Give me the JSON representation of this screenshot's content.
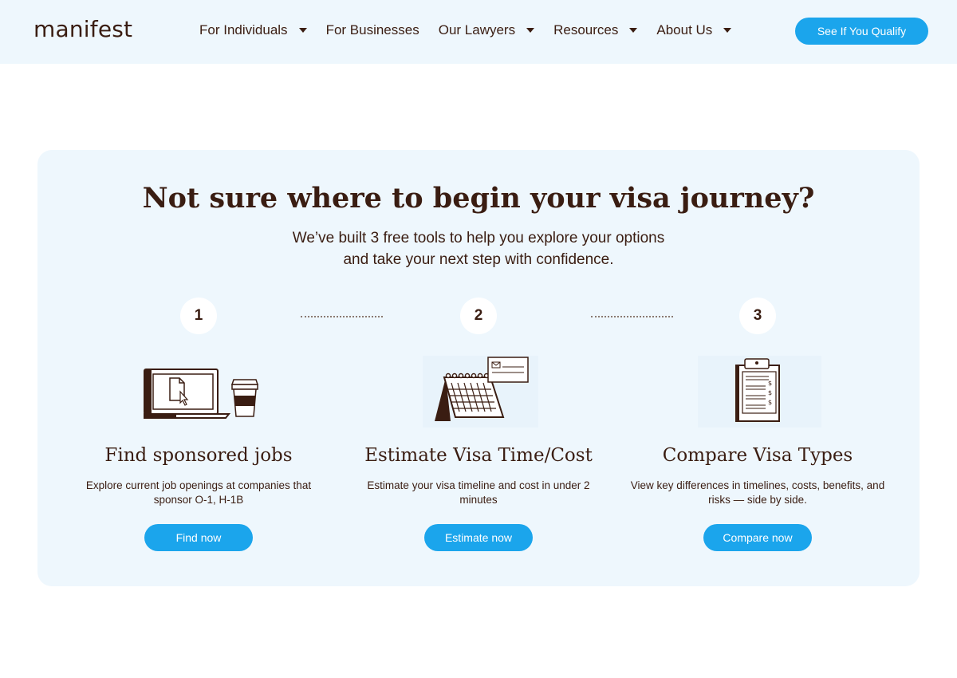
{
  "header": {
    "logo": "manifest",
    "nav": [
      {
        "label": "For Individuals",
        "has_dropdown": true
      },
      {
        "label": "For Businesses",
        "has_dropdown": false
      },
      {
        "label": "Our Lawyers",
        "has_dropdown": true
      },
      {
        "label": "Resources",
        "has_dropdown": true
      },
      {
        "label": "About Us",
        "has_dropdown": true
      }
    ],
    "cta": "See If You Qualify"
  },
  "hero": {
    "title": "Not sure where to begin your visa journey?",
    "subtitle": "We’ve built 3 free tools to help you explore your options and take your next step with confidence."
  },
  "steps": [
    "1",
    "2",
    "3"
  ],
  "tools": [
    {
      "icon": "laptop-coffee-icon",
      "title": "Find sponsored jobs",
      "description": "Explore current job openings at companies that sponsor O-1, H-1B",
      "button": "Find now"
    },
    {
      "icon": "calendar-icon",
      "title": "Estimate Visa Time/Cost",
      "description": "Estimate your visa timeline and cost in under 2 minutes",
      "button": "Estimate now"
    },
    {
      "icon": "clipboard-icon",
      "title": "Compare Visa Types",
      "description": "View key differences in timelines, costs, benefits, and risks — side by side.",
      "button": "Compare now"
    }
  ],
  "colors": {
    "accent": "#1ba5ec",
    "text": "#3a1d12",
    "panel": "#eef7fd"
  }
}
